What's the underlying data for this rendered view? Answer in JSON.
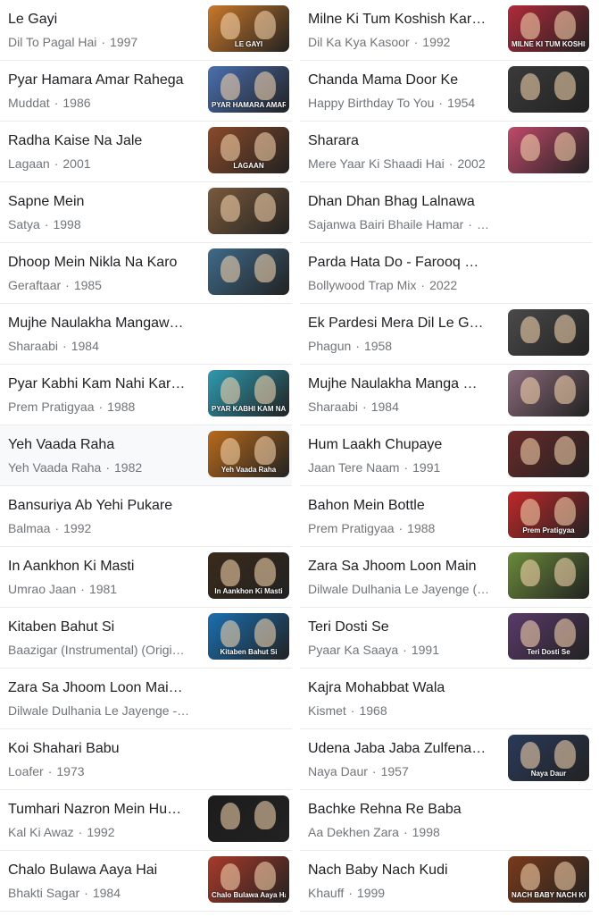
{
  "columns": [
    {
      "items": [
        {
          "title": "Le Gayi",
          "film": "Dil To Pagal Hai",
          "year": "1997",
          "has_thumb": true,
          "thumb_caption": "LE GAYI",
          "thumb_color": "#c9782a"
        },
        {
          "title": "Pyar Hamara Amar Rahega",
          "film": "Muddat",
          "year": "1986",
          "has_thumb": true,
          "thumb_caption": "PYAR HAMARA AMAR RAHEGA",
          "thumb_color": "#4a6fb0"
        },
        {
          "title": "Radha Kaise Na Jale",
          "film": "Lagaan",
          "year": "2001",
          "has_thumb": true,
          "thumb_caption": "LAGAAN",
          "thumb_color": "#8a4a2a"
        },
        {
          "title": "Sapne Mein",
          "film": "Satya",
          "year": "1998",
          "has_thumb": true,
          "thumb_caption": "",
          "thumb_color": "#7a5a3c"
        },
        {
          "title": "Dhoop Mein Nikla Na Karo",
          "film": "Geraftaar",
          "year": "1985",
          "has_thumb": true,
          "thumb_caption": "",
          "thumb_color": "#3f6a8a"
        },
        {
          "title": "Mujhe Naulakha Mangaw…",
          "film": "Sharaabi",
          "year": "1984",
          "has_thumb": false
        },
        {
          "title": "Pyar Kabhi Kam Nahi Karna",
          "film": "Prem Pratigyaa",
          "year": "1988",
          "has_thumb": true,
          "thumb_caption": "PYAR KABHI KAM NAHI KARNA",
          "thumb_color": "#2f9ab0"
        },
        {
          "title": "Yeh Vaada Raha",
          "film": "Yeh Vaada Raha",
          "year": "1982",
          "has_thumb": true,
          "thumb_caption": "Yeh Vaada Raha",
          "thumb_color": "#b86a1c",
          "highlight": true
        },
        {
          "title": "Bansuriya Ab Yehi Pukare",
          "film": "Balmaa",
          "year": "1992",
          "has_thumb": false
        },
        {
          "title": "In Aankhon Ki Masti",
          "film": "Umrao Jaan",
          "year": "1981",
          "has_thumb": true,
          "thumb_caption": "In Aankhon Ki Masti",
          "thumb_color": "#3a2a1a"
        },
        {
          "title": "Kitaben Bahut Si",
          "film": "Baazigar (Instrumental) (Origi…",
          "year": "",
          "has_thumb": true,
          "thumb_caption": "Kitaben Bahut Si",
          "thumb_color": "#1a6fb0"
        },
        {
          "title": "Zara Sa Jhoom Loon Mai…",
          "film": "Dilwale Dulhania Le Jayenge -…",
          "year": "",
          "has_thumb": false
        },
        {
          "title": "Koi Shahari Babu",
          "film": "Loafer",
          "year": "1973",
          "has_thumb": false
        },
        {
          "title": "Tumhari Nazron Mein Hu…",
          "film": "Kal Ki Awaz",
          "year": "1992",
          "has_thumb": true,
          "thumb_caption": "",
          "thumb_color": "#1c1c1c"
        },
        {
          "title": "Chalo Bulawa Aaya Hai",
          "film": "Bhakti Sagar",
          "year": "1984",
          "has_thumb": true,
          "thumb_caption": "Chalo Bulawa Aaya Hai",
          "thumb_color": "#a83a2a"
        }
      ]
    },
    {
      "items": [
        {
          "title": "Milne Ki Tum Koshish Karna",
          "film": "Dil Ka Kya Kasoor",
          "year": "1992",
          "has_thumb": true,
          "thumb_caption": "MILNE KI TUM KOSHISH KARNA",
          "thumb_color": "#b02a3a"
        },
        {
          "title": "Chanda Mama Door Ke",
          "film": "Happy Birthday To You",
          "year": "1954",
          "has_thumb": true,
          "thumb_caption": "",
          "thumb_color": "#3a3a3a"
        },
        {
          "title": "Sharara",
          "film": "Mere Yaar Ki Shaadi Hai",
          "year": "2002",
          "has_thumb": true,
          "thumb_caption": "",
          "thumb_color": "#c04a6a"
        },
        {
          "title": "Dhan Dhan Bhag Lalnawa",
          "film": "Sajanwa Bairi Bhaile Hamar",
          "year": "…",
          "has_thumb": false
        },
        {
          "title": "Parda Hata Do - Farooq G…",
          "film": "Bollywood Trap Mix",
          "year": "2022",
          "has_thumb": false
        },
        {
          "title": "Ek Pardesi Mera Dil Le G…",
          "film": "Phagun",
          "year": "1958",
          "has_thumb": true,
          "thumb_caption": "",
          "thumb_color": "#4a4a4a"
        },
        {
          "title": "Mujhe Naulakha Manga D…",
          "film": "Sharaabi",
          "year": "1984",
          "has_thumb": true,
          "thumb_caption": "",
          "thumb_color": "#8a6a7a"
        },
        {
          "title": "Hum Laakh Chupaye",
          "film": "Jaan Tere Naam",
          "year": "1991",
          "has_thumb": true,
          "thumb_caption": "",
          "thumb_color": "#6a2a2a"
        },
        {
          "title": "Bahon Mein Bottle",
          "film": "Prem Pratigyaa",
          "year": "1988",
          "has_thumb": true,
          "thumb_caption": "Prem Pratigyaa",
          "thumb_color": "#c0282a"
        },
        {
          "title": "Zara Sa Jhoom Loon Main",
          "film": "Dilwale Dulhania Le Jayenge (…",
          "year": "",
          "has_thumb": true,
          "thumb_caption": "",
          "thumb_color": "#6a8a3a"
        },
        {
          "title": "Teri Dosti Se",
          "film": "Pyaar Ka Saaya",
          "year": "1991",
          "has_thumb": true,
          "thumb_caption": "Teri Dosti Se",
          "thumb_color": "#5a3a6a"
        },
        {
          "title": "Kajra Mohabbat Wala",
          "film": "Kismet",
          "year": "1968",
          "has_thumb": false
        },
        {
          "title": "Udena Jaba Jaba Zulfena …",
          "film": "Naya Daur",
          "year": "1957",
          "has_thumb": true,
          "thumb_caption": "Naya Daur",
          "thumb_color": "#2a3a5a"
        },
        {
          "title": "Bachke Rehna Re Baba",
          "film": "Aa Dekhen Zara",
          "year": "1998",
          "has_thumb": false
        },
        {
          "title": "Nach Baby Nach Kudi",
          "film": "Khauff",
          "year": "1999",
          "has_thumb": true,
          "thumb_caption": "NACH BABY NACH KUDI",
          "thumb_color": "#7a3a1a"
        }
      ]
    }
  ]
}
